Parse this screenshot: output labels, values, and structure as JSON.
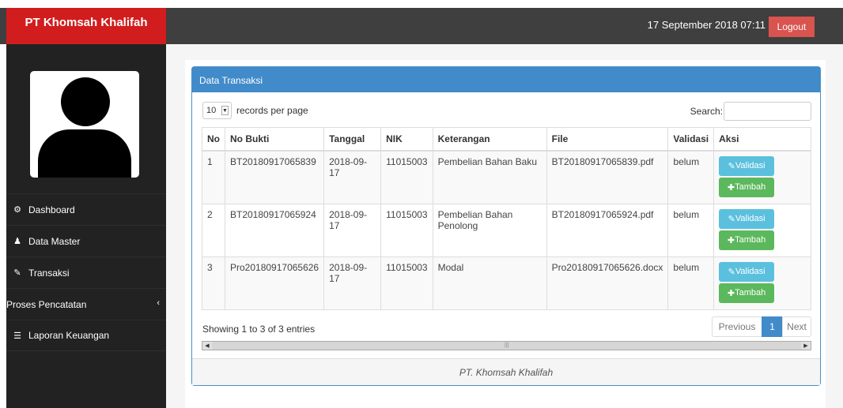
{
  "header": {
    "brand": "PT Khomsah Khalifah",
    "datetime": "17 September 2018 07:11",
    "logout_label": "Logout"
  },
  "sidebar": {
    "items": [
      {
        "label": "Dashboard",
        "icon": "dashboard-icon",
        "glyph": "⚙"
      },
      {
        "label": "Data Master",
        "icon": "user-icon",
        "glyph": "♟"
      },
      {
        "label": "Transaksi",
        "icon": "edit-icon",
        "glyph": "✎"
      },
      {
        "label": "Proses Pencatatan",
        "icon": "chevron-left-icon",
        "glyph": "‹"
      },
      {
        "label": "Laporan Keuangan",
        "icon": "list-icon",
        "glyph": "☰"
      }
    ]
  },
  "panel": {
    "title": "Data Transaksi",
    "footer": "PT. Khomsah Khalifah"
  },
  "table_controls": {
    "length_value": "10",
    "length_suffix": "records per page",
    "search_label": "Search:",
    "info": "Showing 1 to 3 of 3 entries",
    "prev_label": "Previous",
    "current_page": "1",
    "next_label": "Next"
  },
  "table": {
    "columns": [
      "No",
      "No Bukti",
      "Tanggal",
      "NIK",
      "Keterangan",
      "File",
      "Validasi",
      "Aksi"
    ],
    "rows": [
      {
        "no": "1",
        "bukti": "BT20180917065839",
        "tanggal": "2018-09-17",
        "nik": "11015003",
        "keterangan": "Pembelian Bahan Baku",
        "file": "BT20180917065839.pdf",
        "validasi": "belum"
      },
      {
        "no": "2",
        "bukti": "BT20180917065924",
        "tanggal": "2018-09-17",
        "nik": "11015003",
        "keterangan": "Pembelian Bahan Penolong",
        "file": "BT20180917065924.pdf",
        "validasi": "belum"
      },
      {
        "no": "3",
        "bukti": "Pro20180917065626",
        "tanggal": "2018-09-17",
        "nik": "11015003",
        "keterangan": "Modal",
        "file": "Pro20180917065626.docx",
        "validasi": "belum"
      }
    ],
    "validasi_button": "Validasi",
    "tambah_button": "Tambah"
  },
  "colors": {
    "brand_red": "#d11d1d",
    "topbar": "#3f3f3f",
    "sidebar": "#222222",
    "primary": "#428bca",
    "info": "#5bc0de",
    "success": "#5cb85c",
    "logout": "#d9534f"
  }
}
